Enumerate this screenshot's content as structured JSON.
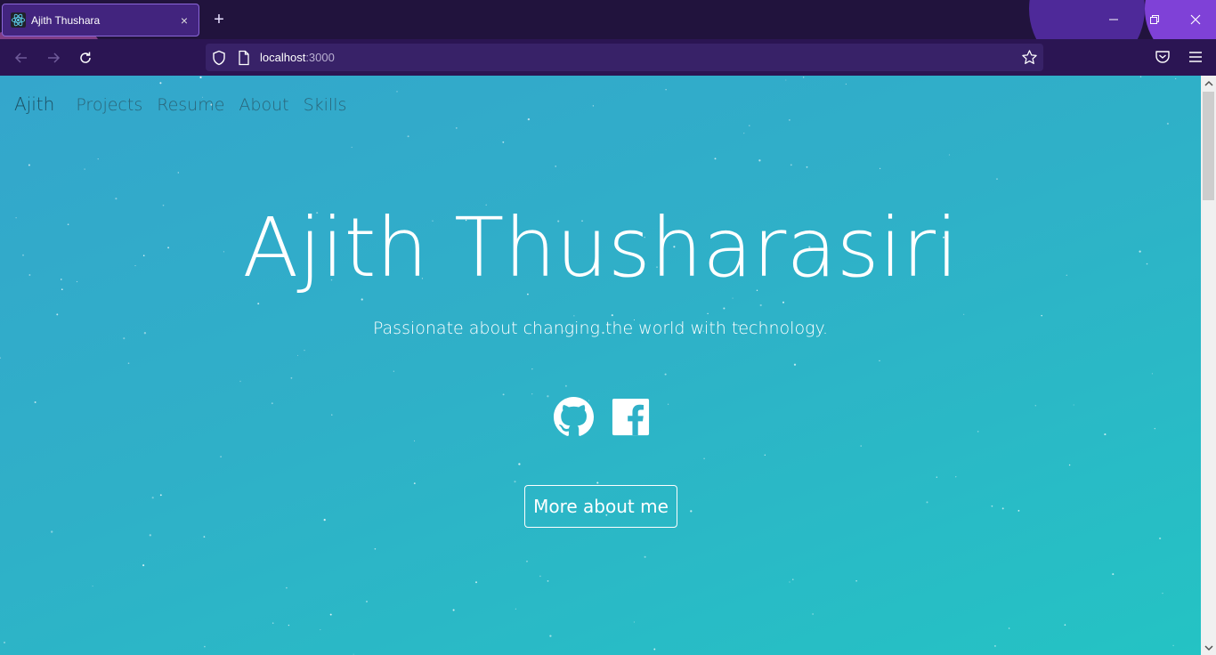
{
  "browser": {
    "tab": {
      "title": "Ajith Thushara",
      "favicon": "react-icon",
      "close": "×"
    },
    "new_tab": "+",
    "url": {
      "host": "localhost",
      "port": ":3000"
    }
  },
  "site": {
    "brand": "Ajith",
    "nav": [
      "Projects",
      "Resume",
      "About",
      "Skills"
    ],
    "hero": {
      "title": "Ajith Thusharasiri",
      "subtitle": "Passionate about changing the world with technology."
    },
    "social": [
      "github-icon",
      "facebook-icon"
    ],
    "cta": "More about me"
  },
  "colors": {
    "gradient_start": "#34a6cc",
    "gradient_end": "#24c3c4",
    "chrome_bg": "#21133d",
    "toolbar_bg": "#2b1553",
    "tab_bg": "#42247e"
  }
}
